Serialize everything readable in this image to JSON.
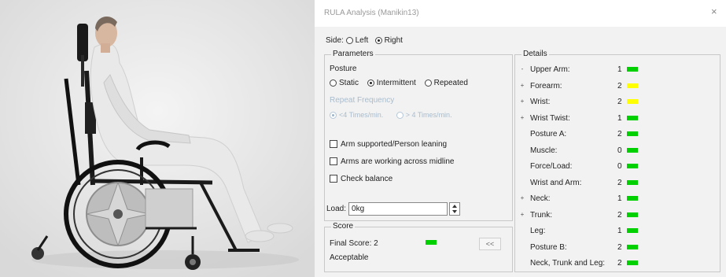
{
  "dialog": {
    "title": "RULA Analysis (Manikin13)",
    "close_glyph": "×"
  },
  "side": {
    "label": "Side:",
    "options": [
      "Left",
      "Right"
    ],
    "selected": "Right"
  },
  "parameters": {
    "title": "Parameters",
    "posture_label": "Posture",
    "posture_options": [
      "Static",
      "Intermittent",
      "Repeated"
    ],
    "posture_selected": "Intermittent",
    "repeat_label": "Repeat Frequency",
    "repeat_options": [
      "<4 Times/min.",
      "> 4 Times/min."
    ],
    "repeat_selected": "<4 Times/min.",
    "checks": [
      {
        "label": "Arm supported/Person leaning",
        "checked": false
      },
      {
        "label": "Arms are working across midline",
        "checked": false
      },
      {
        "label": "Check balance",
        "checked": false
      }
    ],
    "load_label": "Load:",
    "load_value": "0kg"
  },
  "score": {
    "title": "Score",
    "final_label": "Final Score: 2",
    "final_color": "#00d000",
    "collapse_label": "<<",
    "verdict": "Acceptable"
  },
  "details": {
    "title": "Details",
    "colors": {
      "green": "#00d000",
      "yellow": "#ffff00"
    },
    "rows": [
      {
        "expander": "-",
        "label": "Upper Arm:",
        "value": "1",
        "color": "#00d000"
      },
      {
        "expander": "+",
        "label": "Forearm:",
        "value": "2",
        "color": "#ffff00"
      },
      {
        "expander": "+",
        "label": "Wrist:",
        "value": "2",
        "color": "#ffff00"
      },
      {
        "expander": "+",
        "label": "Wrist Twist:",
        "value": "1",
        "color": "#00d000"
      },
      {
        "expander": "",
        "label": "Posture A:",
        "value": "2",
        "color": "#00d000"
      },
      {
        "expander": "",
        "label": "Muscle:",
        "value": "0",
        "color": "#00d000"
      },
      {
        "expander": "",
        "label": "Force/Load:",
        "value": "0",
        "color": "#00d000"
      },
      {
        "expander": "",
        "label": "Wrist and Arm:",
        "value": "2",
        "color": "#00d000"
      },
      {
        "expander": "+",
        "label": "Neck:",
        "value": "1",
        "color": "#00d000"
      },
      {
        "expander": "+",
        "label": "Trunk:",
        "value": "2",
        "color": "#00d000"
      },
      {
        "expander": "",
        "label": "Leg:",
        "value": "1",
        "color": "#00d000"
      },
      {
        "expander": "",
        "label": "Posture B:",
        "value": "2",
        "color": "#00d000"
      },
      {
        "expander": "",
        "label": "Neck, Trunk and Leg:",
        "value": "2",
        "color": "#00d000"
      }
    ]
  }
}
